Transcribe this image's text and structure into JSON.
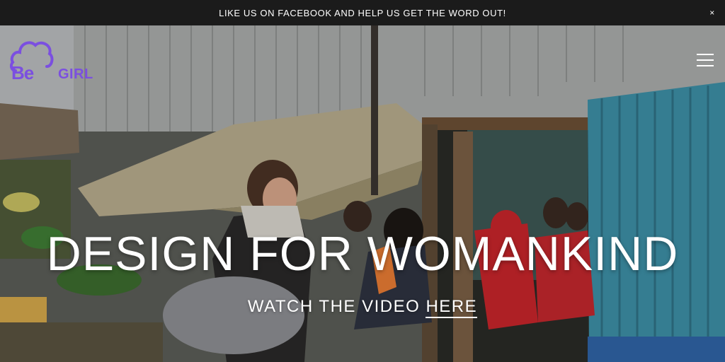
{
  "announcement": {
    "text": "LIKE US ON FACEBOOK AND HELP US GET THE WORD OUT!",
    "close_icon": "×"
  },
  "brand": {
    "logo_be": "Be",
    "logo_girl": "GIRL",
    "color": "#7b4fe0"
  },
  "hero": {
    "headline": "DESIGN FOR WOMANKIND",
    "cta_prefix": "WATCH THE VIDEO",
    "cta_link": "HERE"
  },
  "icons": {
    "menu": "hamburger-menu-icon",
    "close": "close-icon",
    "logo": "cloud-logo-icon"
  }
}
